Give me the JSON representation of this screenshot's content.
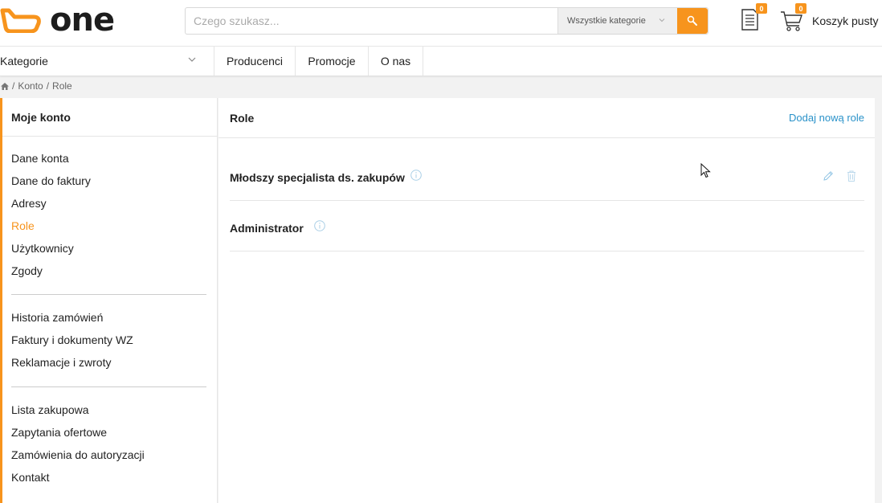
{
  "header": {
    "brand": "one",
    "search": {
      "placeholder": "Czego szukasz...",
      "category": "Wszystkie kategorie"
    },
    "documents_badge": "0",
    "cart_badge": "0",
    "cart_label": "Koszyk pusty",
    "icons": [
      "logo-mark",
      "search-icon",
      "document-icon",
      "cart-icon",
      "chevron-down-icon"
    ],
    "accent_color": "#f7941d"
  },
  "nav": {
    "categories_label": "Kategorie",
    "items": [
      "Producenci",
      "Promocje",
      "O nas"
    ]
  },
  "breadcrumb": [
    "Konto",
    "Role"
  ],
  "sidebar": {
    "title": "Moje konto",
    "groups": [
      [
        "Dane konta",
        "Dane do faktury",
        "Adresy",
        "Role",
        "Użytkownicy",
        "Zgody"
      ],
      [
        "Historia zamówień",
        "Faktury i dokumenty WZ",
        "Reklamacje i zwroty"
      ],
      [
        "Lista zakupowa",
        "Zapytania ofertowe",
        "Zamówienia do autoryzacji",
        "Kontakt"
      ]
    ],
    "active": "Role"
  },
  "main": {
    "title": "Role",
    "add_link": "Dodaj nową role",
    "roles": [
      {
        "name": "Młodszy specjalista ds. zakupów",
        "editable": true
      },
      {
        "name": "Administrator",
        "editable": false
      }
    ]
  }
}
